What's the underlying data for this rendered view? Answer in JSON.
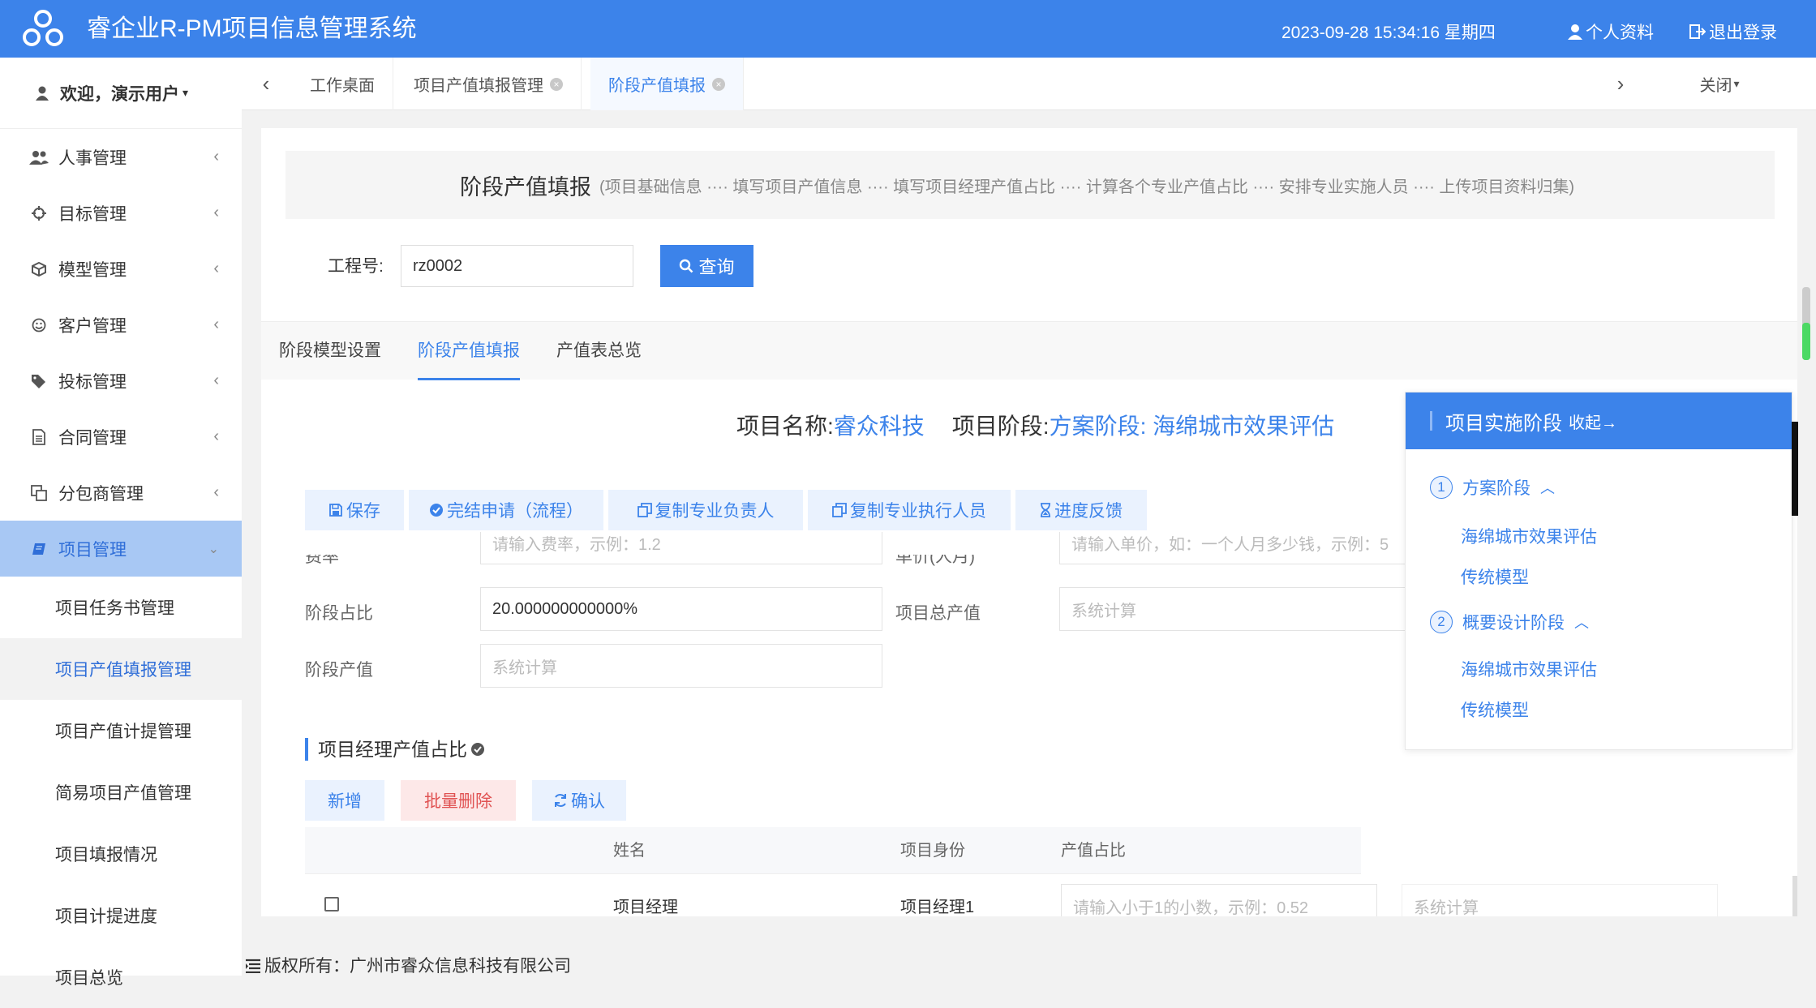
{
  "header": {
    "app_title": "睿企业R-PM项目信息管理系统",
    "datetime": "2023-09-28 15:34:16 星期四",
    "profile_link": "个人资料",
    "logout_link": "退出登录"
  },
  "sidebar": {
    "welcome": "欢迎，演示用户",
    "items": [
      {
        "label": "人事管理",
        "icon": "users-icon"
      },
      {
        "label": "目标管理",
        "icon": "crosshair-icon"
      },
      {
        "label": "模型管理",
        "icon": "cube-icon"
      },
      {
        "label": "客户管理",
        "icon": "smile-icon"
      },
      {
        "label": "投标管理",
        "icon": "tags-icon"
      },
      {
        "label": "合同管理",
        "icon": "document-icon"
      },
      {
        "label": "分包商管理",
        "icon": "copy-icon"
      },
      {
        "label": "项目管理",
        "icon": "book-icon"
      }
    ],
    "sub_items": [
      "项目任务书管理",
      "项目产值填报管理",
      "项目产值计提管理",
      "简易项目产值管理",
      "项目填报情况",
      "项目计提进度",
      "项目总览"
    ]
  },
  "tabs": {
    "items": [
      "工作桌面",
      "项目产值填报管理",
      "阶段产值填报"
    ],
    "close_label": "关闭"
  },
  "banner": {
    "title": "阶段产值填报",
    "steps": "(项目基础信息 ···· 填写项目产值信息 ···· 填写项目经理产值占比 ···· 计算各个专业产值占比 ···· 安排专业实施人员 ···· 上传项目资料归集)"
  },
  "search": {
    "label": "工程号:",
    "value": "rz0002",
    "button": "查询"
  },
  "inner_tabs": [
    "阶段模型设置",
    "阶段产值填报",
    "产值表总览"
  ],
  "project": {
    "name_label": "项目名称:",
    "name_value": "睿众科技",
    "stage_label": "项目阶段:",
    "stage_value": "方案阶段: 海绵城市效果评估"
  },
  "actions": {
    "save": "保存",
    "complete": "完结申请（流程）",
    "copy_leader": "复制专业负责人",
    "copy_executor": "复制专业执行人员",
    "feedback": "进度反馈"
  },
  "form": {
    "rate_label": "费率",
    "rate_placeholder": "请输入费率，示例：1.2",
    "price_label": "单价(人月)",
    "price_placeholder": "请输入单价，如：一个人月多少钱，示例：5",
    "stage_ratio_label": "阶段占比",
    "stage_ratio_value": "20.000000000000%",
    "total_label": "项目总产值",
    "total_placeholder": "系统计算",
    "stage_value_label": "阶段产值",
    "stage_value_placeholder": "系统计算"
  },
  "manager_section": {
    "title": "项目经理产值占比",
    "add": "新增",
    "batch_delete": "批量删除",
    "confirm": "确认",
    "columns": [
      "姓名",
      "项目身份",
      "产值占比"
    ],
    "rows": [
      {
        "name": "项目经理",
        "role": "项目经理1",
        "ratio_placeholder": "请输入小于1的小数，示例：0.52",
        "calc_placeholder": "系统计算"
      }
    ]
  },
  "stage_panel": {
    "title": "项目实施阶段",
    "collapse": "收起→",
    "stages": [
      {
        "num": "1",
        "name": "方案阶段",
        "subs": [
          "海绵城市效果评估",
          "传统模型"
        ]
      },
      {
        "num": "2",
        "name": "概要设计阶段",
        "subs": [
          "海绵城市效果评估",
          "传统模型"
        ]
      }
    ]
  },
  "footer": {
    "copyright": "版权所有：广州市睿众信息科技有限公司"
  }
}
